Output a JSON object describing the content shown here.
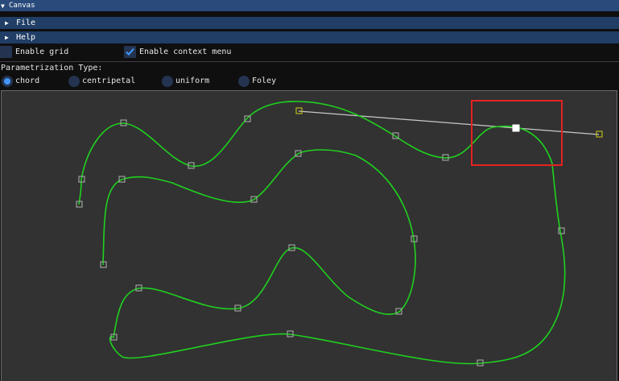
{
  "window": {
    "title": "Canvas",
    "collapse_icon": "triangle-down-icon"
  },
  "menus": {
    "file_label": "File",
    "help_label": "Help",
    "expand_icon": "triangle-right-icon"
  },
  "options": {
    "enable_grid_label": "Enable grid",
    "enable_grid_checked": false,
    "enable_context_menu_label": "Enable context menu",
    "enable_context_menu_checked": true
  },
  "parametrization": {
    "label": "Parametrization Type:",
    "selected": "chord",
    "options": [
      "chord",
      "centripetal",
      "uniform",
      "Foley"
    ]
  },
  "colors": {
    "title_bar": "#294a7a",
    "header_bar": "#203e66",
    "curve": "#1fd11f",
    "control_point": "#9aa09a",
    "endpoint_handle": "#b4b41e",
    "tangent_line": "#c8c8c8",
    "selection_box": "#e52222",
    "selected_point": "#ffffff",
    "radio_selected": "#4296fa",
    "canvas_background": "#323232"
  }
}
